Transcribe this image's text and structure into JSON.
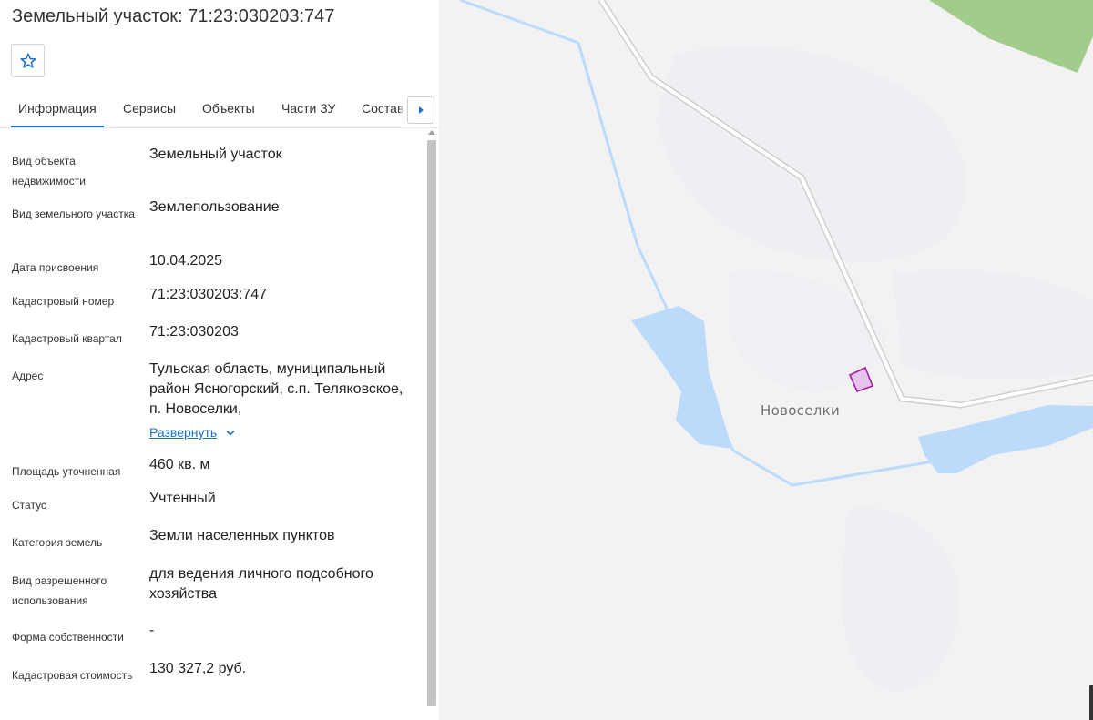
{
  "title": "Земельный участок: 71:23:030203:747",
  "favorite": {
    "icon": "star-outline-icon"
  },
  "tabs": [
    {
      "label": "Информация",
      "active": true
    },
    {
      "label": "Сервисы"
    },
    {
      "label": "Объекты"
    },
    {
      "label": "Части ЗУ"
    },
    {
      "label": "Состав"
    }
  ],
  "tabs_next_icon": "triangle-right-icon",
  "fields": {
    "object_type": {
      "label": "Вид объекта недвижимости",
      "value": "Земельный участок"
    },
    "land_type": {
      "label": "Вид земельного участка",
      "value": "Землепользование"
    },
    "assign_date": {
      "label": "Дата присвоения",
      "value": "10.04.2025"
    },
    "cad_number": {
      "label": "Кадастровый номер",
      "value": "71:23:030203:747"
    },
    "cad_quarter": {
      "label": "Кадастровый квартал",
      "value": "71:23:030203"
    },
    "address": {
      "label": "Адрес",
      "value": "Тульская область, муниципальный район Ясногорский, с.п. Теляковское, п. Новоселки,",
      "expand_label": "Развернуть"
    },
    "area": {
      "label": "Площадь уточненная",
      "value": "460 кв. м"
    },
    "status": {
      "label": "Статус",
      "value": "Учтенный"
    },
    "category": {
      "label": "Категория земель",
      "value": "Земли населенных пунктов"
    },
    "permitted_use": {
      "label": "Вид разрешенного использования",
      "value": "для ведения личного подсобного хозяйства"
    },
    "ownership": {
      "label": "Форма собственности",
      "value": "-"
    },
    "cad_value": {
      "label": "Кадастровая стоимость",
      "value": "130 327,2 руб."
    }
  },
  "map": {
    "place_label": "Новоселки",
    "colors": {
      "water": "#bcdbfb",
      "forest": "#a3cc8c",
      "parcel_fill": "#e6c3ea",
      "parcel_stroke": "#a21fa8",
      "accent": "#1a72c8"
    }
  }
}
